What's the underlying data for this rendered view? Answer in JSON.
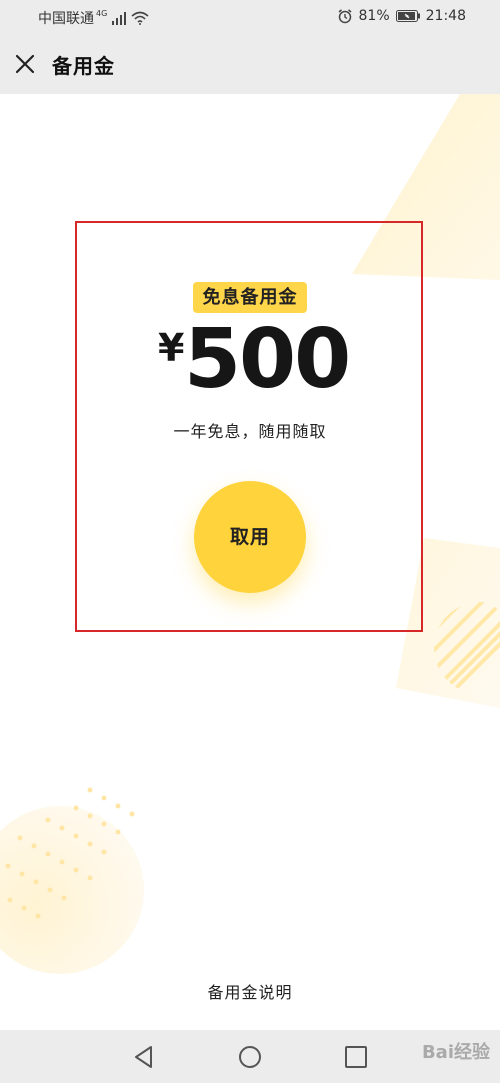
{
  "status_bar": {
    "carrier": "中国联通",
    "network": "4G",
    "battery": "81%",
    "time": "21:48"
  },
  "header": {
    "title": "备用金"
  },
  "card": {
    "badge": "免息备用金",
    "currency_symbol": "¥",
    "amount": "500",
    "subtitle": "一年免息，随用随取",
    "button_label": "取用"
  },
  "footer": {
    "link_label": "备用金说明"
  },
  "watermark": {
    "text": "Bai经验"
  },
  "colors": {
    "accent": "#ffd33b",
    "badge_bg": "#ffd54a",
    "highlight_border": "#d62828",
    "bar_bg": "#ececec"
  },
  "icons": {
    "close": "close-icon",
    "back": "back-icon",
    "home": "home-icon",
    "recent": "recent-apps-icon"
  }
}
